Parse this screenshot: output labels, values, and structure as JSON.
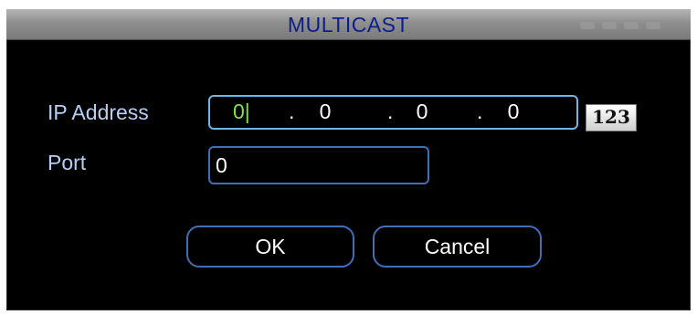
{
  "dialog": {
    "title": "MULTICAST"
  },
  "form": {
    "ip_label": "IP Address",
    "ip_segments": [
      "0",
      "0",
      "0",
      "0"
    ],
    "ip_separator": ".",
    "keyboard_button": "123",
    "port_label": "Port",
    "port_value": "0"
  },
  "buttons": {
    "ok": "OK",
    "cancel": "Cancel"
  },
  "colors": {
    "label_text": "#b7cff5",
    "active_segment": "#7fe34c",
    "field_border_focus": "#6fb6e8",
    "field_border": "#3f6fb7",
    "title_text": "#0b1f8a"
  }
}
